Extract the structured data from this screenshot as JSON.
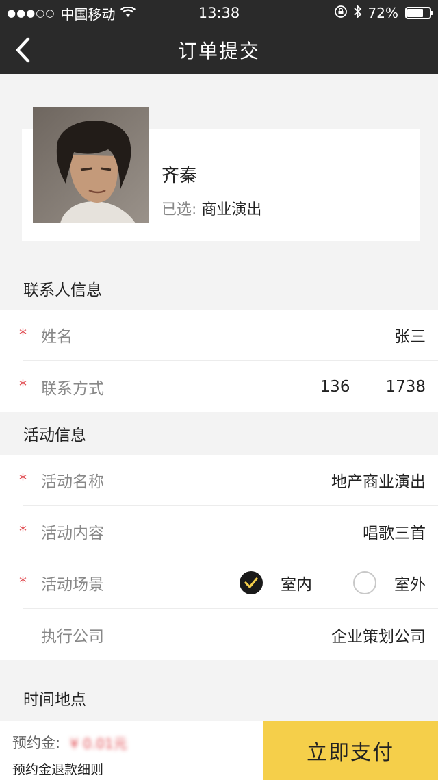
{
  "status_bar": {
    "signal": "●●●○○",
    "carrier": "中国移动",
    "time": "13:38",
    "battery": "72%",
    "battery_level": 0.72
  },
  "nav": {
    "title": "订单提交"
  },
  "artist": {
    "name": "齐秦",
    "selected_label": "已选:",
    "selected_value": "商业演出"
  },
  "contact": {
    "header": "联系人信息",
    "name_label": "姓名",
    "name_value": "张三",
    "phone_label": "联系方式",
    "phone_part1": "136",
    "phone_part2": "1738",
    "required_mark": "*"
  },
  "activity": {
    "header": "活动信息",
    "name_label": "活动名称",
    "name_value": "地产商业演出",
    "content_label": "活动内容",
    "content_value": "唱歌三首",
    "scene_label": "活动场景",
    "scene_options": [
      "室内",
      "室外"
    ],
    "scene_selected": "室内",
    "company_label": "执行公司",
    "company_value": "企业策划公司"
  },
  "time_place": {
    "header": "时间地点"
  },
  "bottom": {
    "deposit_label": "预约金:",
    "deposit_amount": "¥ 0.01元",
    "refund_link": "预约金退款细则",
    "pay_button": "立即支付"
  },
  "colors": {
    "accent": "#f5cf4a",
    "required": "#e0484e",
    "nav_bg": "#2a2a2a"
  }
}
